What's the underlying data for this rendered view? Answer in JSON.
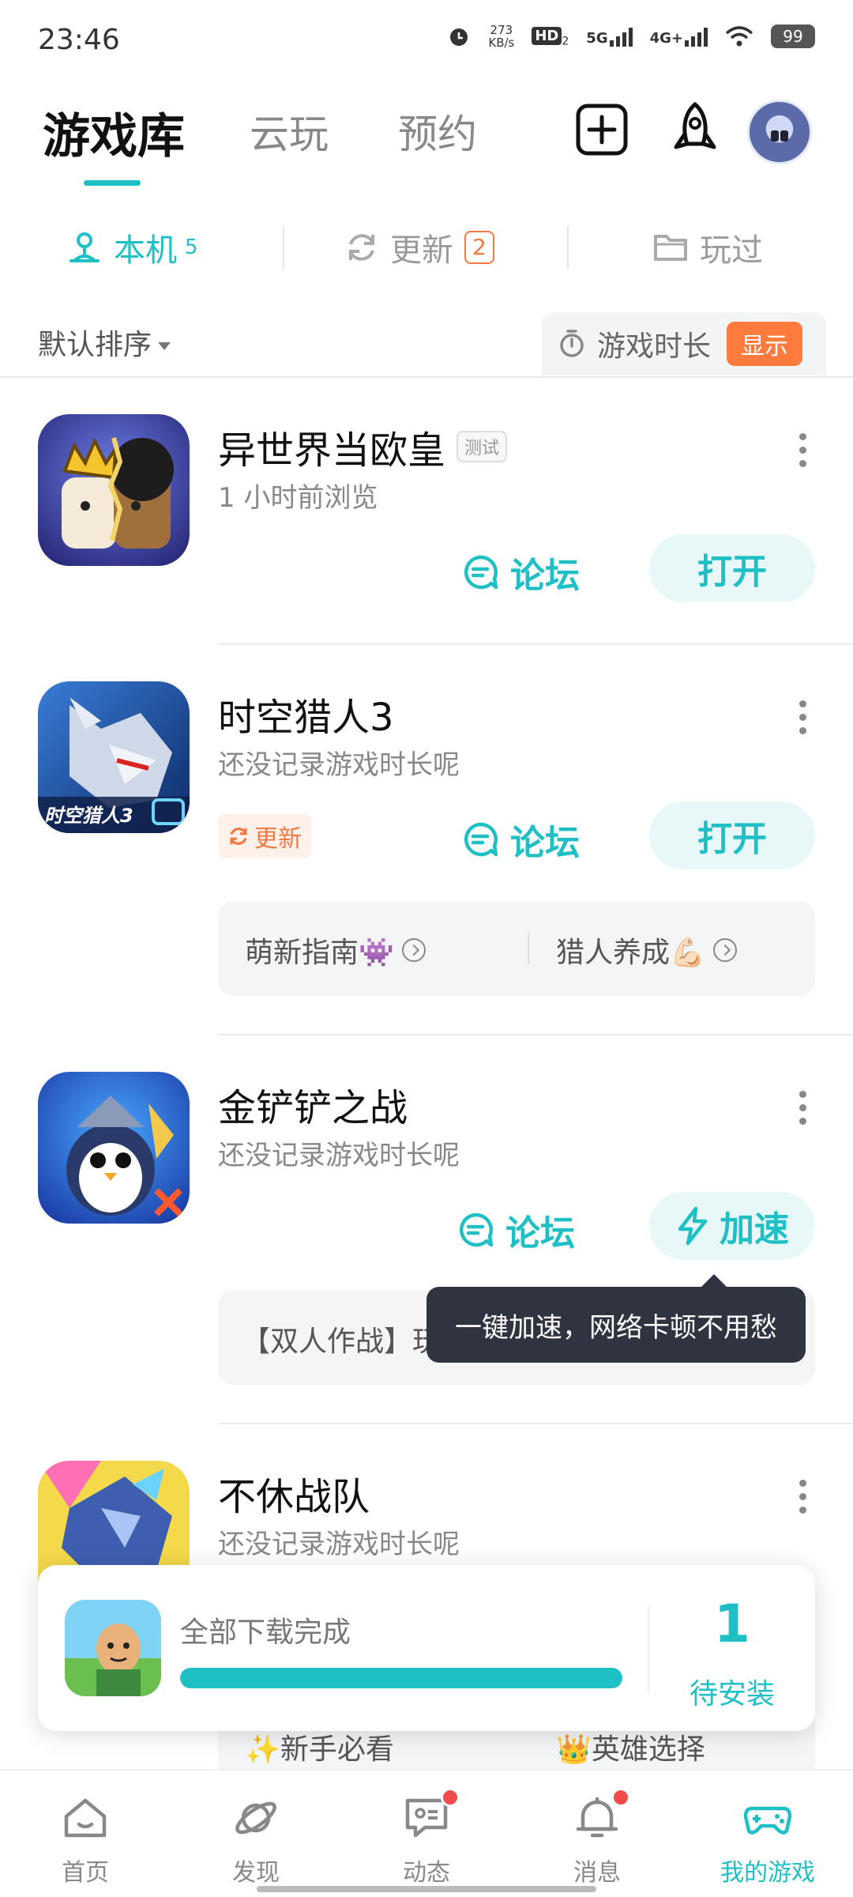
{
  "status_bar": {
    "time": "23:46",
    "net_speed_value": "273",
    "net_speed_unit": "KB/s",
    "hd": "HD",
    "hd_sub": "2",
    "sig1": "5G",
    "sig2": "4G+",
    "battery": "99"
  },
  "header": {
    "tabs": [
      {
        "label": "游戏库",
        "active": true
      },
      {
        "label": "云玩",
        "active": false
      },
      {
        "label": "预约",
        "active": false
      }
    ],
    "icons": [
      "plus-square-icon",
      "rocket-icon",
      "avatar"
    ]
  },
  "subtabs": [
    {
      "label": "本机",
      "count": "5",
      "active": true,
      "icon": "phone-stand-icon"
    },
    {
      "label": "更新",
      "badge": "2",
      "active": false,
      "icon": "refresh-icon"
    },
    {
      "label": "玩过",
      "active": false,
      "icon": "folder-icon"
    }
  ],
  "sort": {
    "label": "默认排序",
    "duration_label": "游戏时长",
    "show_label": "显示"
  },
  "games": [
    {
      "name": "异世界当欧皇",
      "tag": "测试",
      "subtitle": "1 小时前浏览",
      "forum_label": "论坛",
      "action_label": "打开"
    },
    {
      "name": "时空猎人3",
      "subtitle": "还没记录游戏时长呢",
      "update_label": "更新",
      "forum_label": "论坛",
      "action_label": "打开",
      "icon_text": "时空猎人3",
      "guides": [
        "萌新指南👾",
        "猎人养成💪🏻"
      ]
    },
    {
      "name": "金铲铲之战",
      "subtitle": "还没记录游戏时长呢",
      "forum_label": "论坛",
      "action_label": "加速",
      "guide_partial": "【双人作战】玩"
    },
    {
      "name": "不休战队",
      "subtitle": "还没记录游戏时长呢",
      "guides_partial": [
        "✨新手必看",
        "👑英雄选择"
      ]
    }
  ],
  "tooltip": "一键加速，网络卡顿不用愁",
  "download": {
    "title": "全部下载完成",
    "progress": 1.0,
    "count": "1",
    "pending_label": "待安装"
  },
  "bottom_nav": [
    {
      "label": "首页",
      "icon": "home-icon",
      "dot": false
    },
    {
      "label": "发现",
      "icon": "planet-icon",
      "dot": false
    },
    {
      "label": "动态",
      "icon": "chat-icon",
      "dot": true
    },
    {
      "label": "消息",
      "icon": "bell-icon",
      "dot": true
    },
    {
      "label": "我的游戏",
      "icon": "gamepad-icon",
      "dot": false,
      "active": true
    }
  ],
  "colors": {
    "accent": "#1fbfc6",
    "orange": "#f07a43",
    "show_button": "#ff7a3d",
    "tooltip_bg": "#2f3440"
  }
}
